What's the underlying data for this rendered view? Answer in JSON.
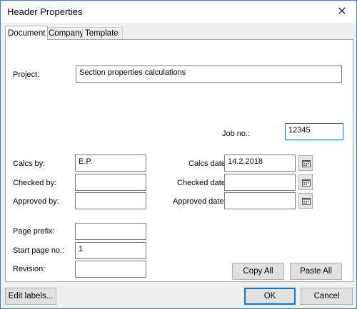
{
  "window": {
    "title": "Header Properties",
    "close_glyph": "✕"
  },
  "tabs": [
    {
      "label": "Document",
      "active": true
    },
    {
      "label": "Company",
      "active": false
    },
    {
      "label": "Template",
      "active": false
    }
  ],
  "fields": {
    "project": {
      "label": "Project:",
      "value": "Section properties calculations"
    },
    "job_no": {
      "label": "Job no.:",
      "value": "12345"
    },
    "calcs_by": {
      "label": "Calcs by:",
      "value": "E.P."
    },
    "checked_by": {
      "label": "Checked by:",
      "value": ""
    },
    "approved_by": {
      "label": "Approved by:",
      "value": ""
    },
    "calcs_date": {
      "label": "Calcs date:",
      "value": "14.2.2018"
    },
    "checked_date": {
      "label": "Checked date:",
      "value": ""
    },
    "approved_date": {
      "label": "Approved date:",
      "value": ""
    },
    "page_prefix": {
      "label": "Page prefix:",
      "value": ""
    },
    "start_page_no": {
      "label": "Start page no.:",
      "value": "1"
    },
    "revision": {
      "label": "Revision:",
      "value": ""
    }
  },
  "buttons": {
    "copy_all": "Copy All",
    "paste_all": "Paste All",
    "edit_labels": "Edit labels...",
    "ok": "OK",
    "cancel": "Cancel"
  },
  "icons": {
    "calendar": "calendar-icon"
  }
}
